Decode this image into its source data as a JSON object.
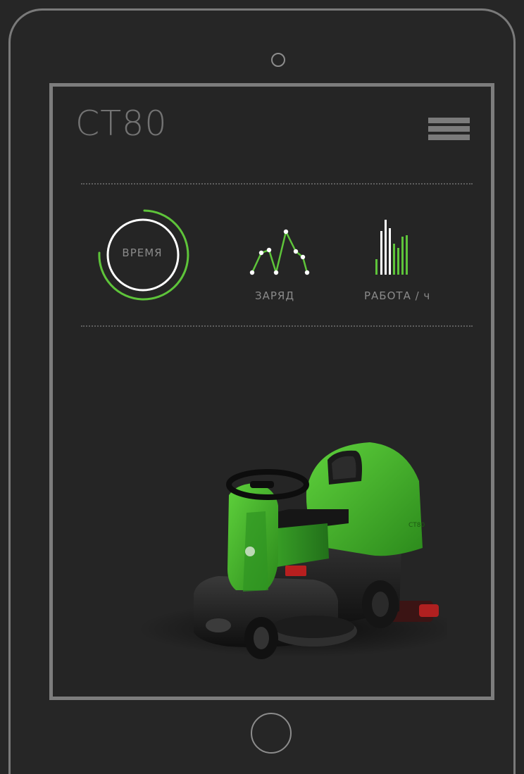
{
  "app": {
    "title": "CT80"
  },
  "stats": {
    "time": {
      "label": "ВРЕМЯ"
    },
    "charge": {
      "label": "ЗАРЯД"
    },
    "work": {
      "label": "РАБОТА / ч"
    }
  },
  "colors": {
    "accent": "#5ec43a",
    "frame": "#7d7d7d",
    "background": "#252525",
    "text": "#8a8a8a"
  },
  "icons": {
    "menu": "hamburger-icon",
    "time": "time-ring-icon",
    "charge": "line-chart-icon",
    "work": "bar-chart-icon",
    "camera": "camera-icon",
    "home": "home-button"
  },
  "product": {
    "name": "CT80 ride-on floor scrubber",
    "body_text": "CT80"
  }
}
